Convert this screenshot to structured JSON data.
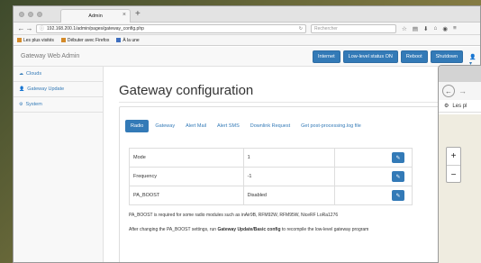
{
  "browser": {
    "tab_title": "Admin",
    "tab_close": "×",
    "new_tab": "+",
    "url": "192.168.200.1/admin/pages/gateway_config.php",
    "search_placeholder": "Rechercher",
    "nav": {
      "back": "←",
      "forward": "→",
      "info": "ⓘ",
      "reload": "↻"
    },
    "toolbar_icons": [
      "☆",
      "▤",
      "⬇",
      "⌂",
      "◉",
      "≡"
    ],
    "bookmarks": [
      "Les plus visités",
      "Débuter avec Firefox",
      "À la une"
    ]
  },
  "app": {
    "brand": "Gateway Web Admin",
    "nav_buttons": [
      "Internet",
      "Low-level status ON",
      "Reboot",
      "Shutdown"
    ],
    "user_icon": "👤 ▾",
    "sidebar": [
      {
        "icon": "☁",
        "label": "Clouds"
      },
      {
        "icon": "👤",
        "label": "Gateway Update"
      },
      {
        "icon": "⚙",
        "label": "System"
      }
    ]
  },
  "main": {
    "title": "Gateway configuration",
    "tabs": [
      "Radio",
      "Gateway",
      "Alert Mail",
      "Alert SMS",
      "Downlink Request",
      "Get post-processing.log file"
    ],
    "active_tab": "Radio",
    "rows": [
      {
        "name": "Mode",
        "value": "1"
      },
      {
        "name": "Frequency",
        "value": "-1"
      },
      {
        "name": "PA_BOOST",
        "value": "Disabled"
      }
    ],
    "edit_icon": "✎",
    "note1": "PA_BOOST is required for some radio modules such as inAir9B, RFM92W, RFM95W, NiceRF LoRa1276",
    "note2_pre": "After changing the PA_BOOST settings, run ",
    "note2_bold": "Gateway Update/Basic config",
    "note2_post": " to recompile the low-level gateway program"
  },
  "second_window": {
    "back_icon": "←",
    "forward_icon": "→",
    "gear_icon": "⚙",
    "bar_text": "Les pl",
    "zoom_in": "+",
    "zoom_out": "−"
  }
}
